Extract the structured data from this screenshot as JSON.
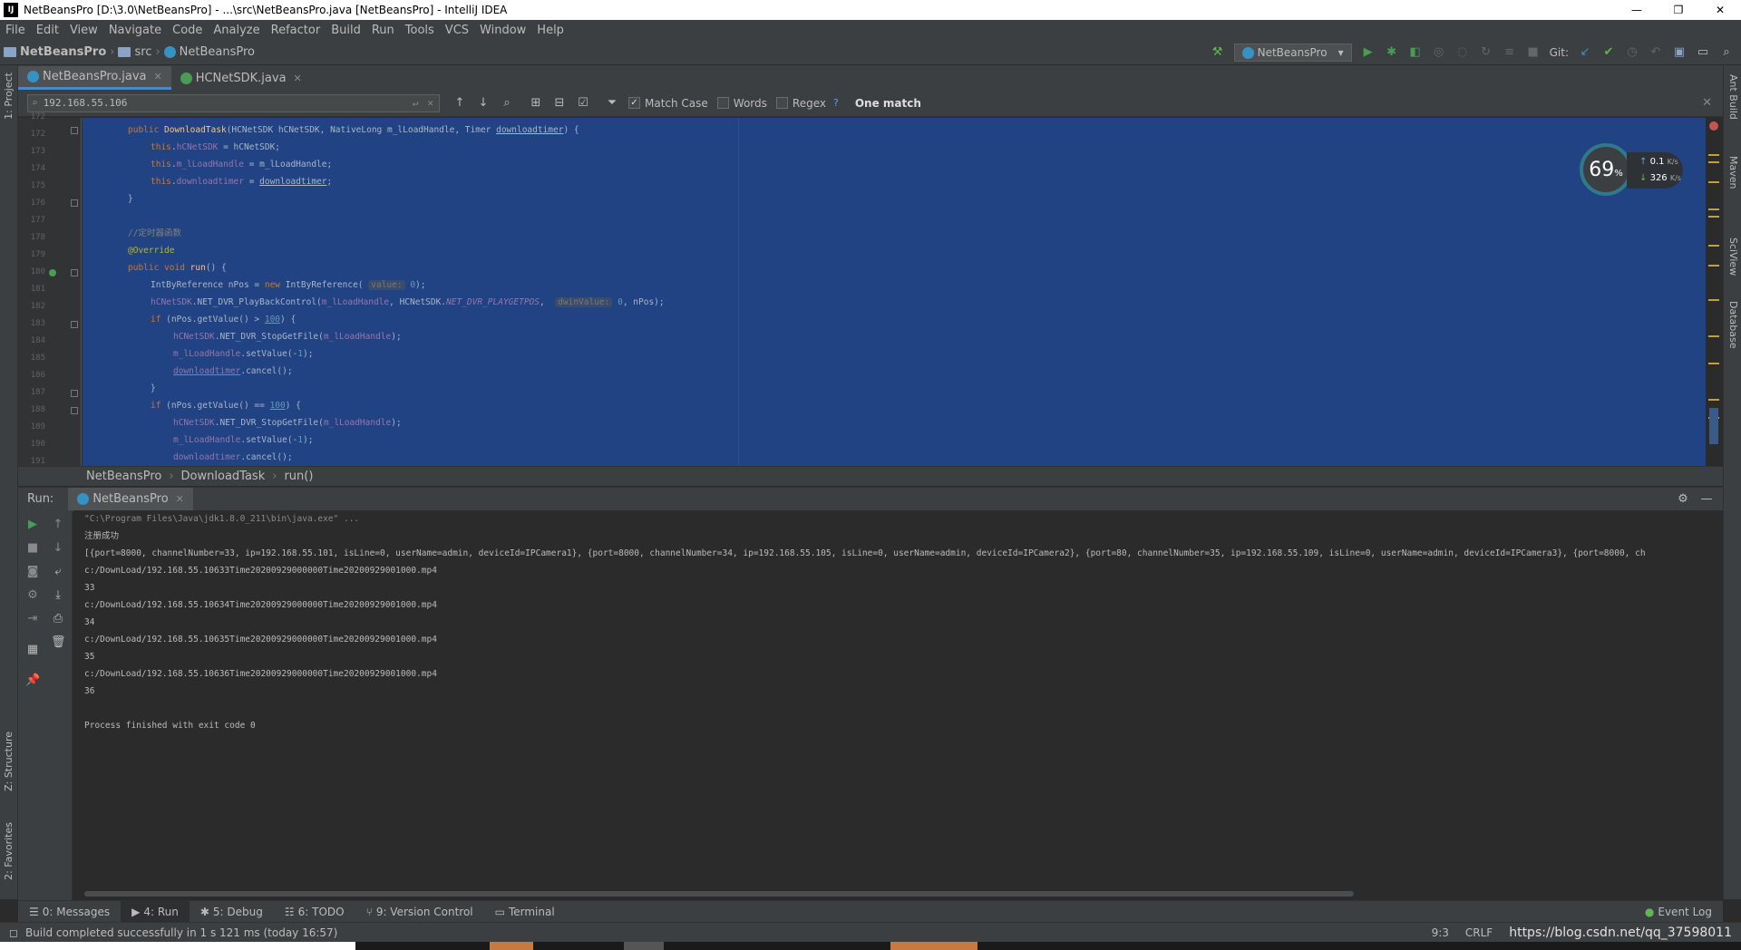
{
  "window": {
    "title": "NetBeansPro [D:\\3.0\\NetBeansPro] - ...\\src\\NetBeansPro.java [NetBeansPro] - IntelliJ IDEA",
    "minimize": "—",
    "maximize": "❐",
    "close": "✕"
  },
  "menu": [
    "File",
    "Edit",
    "View",
    "Navigate",
    "Code",
    "Analyze",
    "Refactor",
    "Build",
    "Run",
    "Tools",
    "VCS",
    "Window",
    "Help"
  ],
  "nav": {
    "project": "NetBeansPro",
    "folder": "src",
    "file": "NetBeansPro",
    "run_config": "NetBeansPro",
    "git_label": "Git:"
  },
  "left_strip": {
    "project": "1: Project",
    "structure": "Z: Structure",
    "favorites": "2: Favorites"
  },
  "right_strip": {
    "ant": "Ant Build",
    "maven": "Maven",
    "sciview": "SciView",
    "database": "Database"
  },
  "tabs": [
    {
      "label": "NetBeansPro.java",
      "close": "✕"
    },
    {
      "label": "HCNetSDK.java",
      "close": "✕"
    }
  ],
  "find": {
    "query": "192.168.55.106",
    "match_case": "Match Case",
    "words": "Words",
    "regex": "Regex",
    "help": "?",
    "result": "One match"
  },
  "editor": {
    "line_numbers": [
      "172",
      "172",
      "173",
      "174",
      "175",
      "176",
      "177",
      "178",
      "179",
      "180",
      "181",
      "182",
      "183",
      "184",
      "185",
      "186",
      "187",
      "188",
      "189",
      "190",
      "191"
    ],
    "hints": {
      "value": "value:",
      "dwin": "dwinValue:"
    }
  },
  "speed": {
    "percent": "69",
    "unit": "%",
    "up": "0.1",
    "up_unit": "K/s",
    "down": "326",
    "down_unit": "K/s"
  },
  "breadcrumb": [
    "NetBeansPro",
    "DownloadTask",
    "run()"
  ],
  "run": {
    "label": "Run:",
    "tab": "NetBeansPro",
    "close": "✕",
    "console": [
      "\"C:\\Program Files\\Java\\jdk1.8.0_211\\bin\\java.exe\" ...",
      "注册成功",
      "[{port=8000, channelNumber=33, ip=192.168.55.101, isLine=0, userName=admin, deviceId=IPCamera1}, {port=8000, channelNumber=34, ip=192.168.55.105, isLine=0, userName=admin, deviceId=IPCamera2}, {port=80, channelNumber=35, ip=192.168.55.109, isLine=0, userName=admin, deviceId=IPCamera3}, {port=8000, ch",
      "c:/DownLoad/192.168.55.10633Time20200929000000Time20200929001000.mp4",
      "33",
      "c:/DownLoad/192.168.55.10634Time20200929000000Time20200929001000.mp4",
      "34",
      "c:/DownLoad/192.168.55.10635Time20200929000000Time20200929001000.mp4",
      "35",
      "c:/DownLoad/192.168.55.10636Time20200929000000Time20200929001000.mp4",
      "36",
      "",
      "Process finished with exit code 0"
    ]
  },
  "bottom_tabs": [
    "0: Messages",
    "4: Run",
    "5: Debug",
    "6: TODO",
    "9: Version Control",
    "Terminal",
    "Event Log"
  ],
  "status": {
    "message": "Build completed successfully in 1 s 121 ms (today 16:57)",
    "position": "9:3",
    "line_sep": "CRLF",
    "encoding_overlay": "https://blog.csdn.net/qq_37598011"
  },
  "colors": {
    "accent": "#4a88c7",
    "selection": "#214283",
    "run_green": "#499c54"
  }
}
